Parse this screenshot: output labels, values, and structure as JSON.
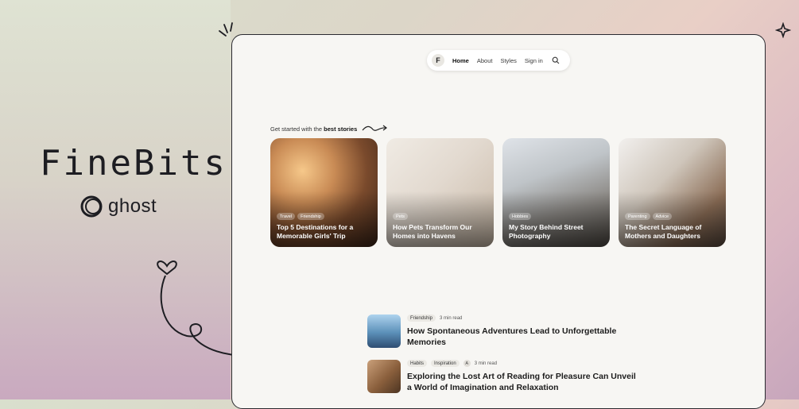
{
  "brand": {
    "name": "FineBits",
    "platform": "ghost"
  },
  "nav": {
    "logo_letter": "F",
    "items": [
      "Home",
      "About",
      "Styles",
      "Sign in"
    ],
    "active": "Home"
  },
  "intro": {
    "prefix": "Get started with the",
    "highlight": "best stories"
  },
  "featured": [
    {
      "tags": [
        "Travel",
        "Friendship"
      ],
      "title": "Top 5 Destinations for a Memorable Girls' Trip"
    },
    {
      "tags": [
        "Pets"
      ],
      "title": "How Pets Transform Our Homes into Havens"
    },
    {
      "tags": [
        "Hobbies"
      ],
      "title": "My Story Behind Street Photography"
    },
    {
      "tags": [
        "Parenting",
        "Advice"
      ],
      "title": "The Secret Language of Mothers and Daughters"
    }
  ],
  "articles": [
    {
      "tags": [
        "Friendship"
      ],
      "read_time": "3 min read",
      "author_initial": "",
      "title": "How Spontaneous Adventures Lead to Unforgettable Memories"
    },
    {
      "tags": [
        "Habits",
        "Inspiration"
      ],
      "read_time": "3 min read",
      "author_initial": "A",
      "title": "Exploring the Lost Art of Reading for Pleasure Can Unveil a World of Imagination and Relaxation"
    }
  ],
  "colors": {
    "frame": "#2a2a30",
    "page_bg": "#f7f6f3",
    "text_dark": "#1c1c1c"
  }
}
